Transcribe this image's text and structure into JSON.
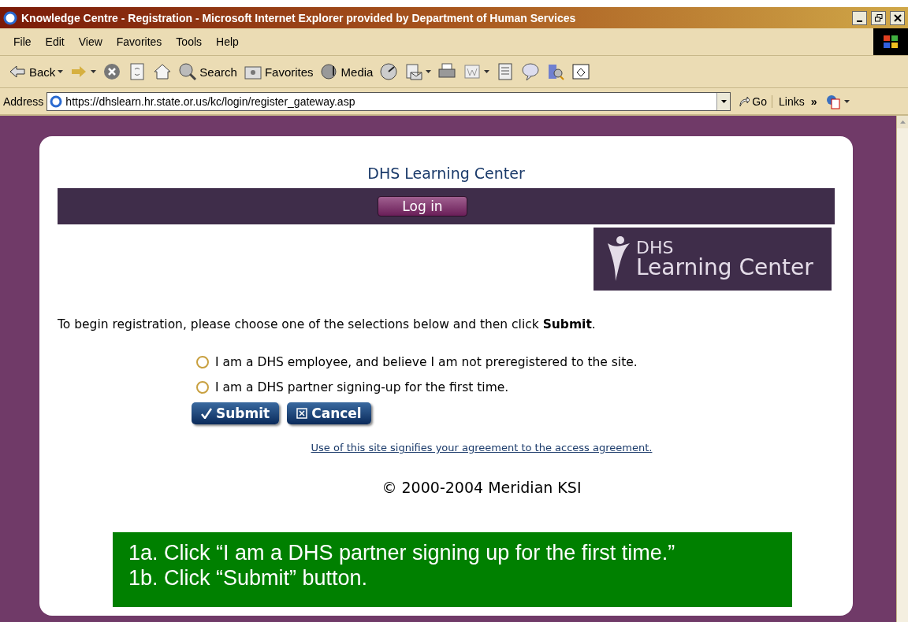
{
  "window": {
    "title": "Knowledge Centre - Registration - Microsoft Internet Explorer provided by Department of Human Services"
  },
  "menu": [
    "File",
    "Edit",
    "View",
    "Favorites",
    "Tools",
    "Help"
  ],
  "toolbar": [
    {
      "kind": "back",
      "label": "Back"
    },
    {
      "kind": "forward"
    },
    {
      "kind": "stop"
    },
    {
      "kind": "refresh"
    },
    {
      "kind": "home"
    },
    {
      "kind": "search",
      "label": "Search"
    },
    {
      "kind": "favorites",
      "label": "Favorites"
    },
    {
      "kind": "media",
      "label": "Media"
    },
    {
      "kind": "history"
    },
    {
      "kind": "mail"
    },
    {
      "kind": "print"
    },
    {
      "kind": "edit"
    },
    {
      "kind": "discuss"
    },
    {
      "kind": "messenger"
    },
    {
      "kind": "research"
    },
    {
      "kind": "window"
    }
  ],
  "address": {
    "label": "Address",
    "value": "https://dhslearn.hr.state.or.us/kc/login/register_gateway.asp",
    "go": "Go",
    "links": "Links",
    "more": "»"
  },
  "page": {
    "heading": "DHS Learning Center",
    "login_button": "Log in",
    "logo": [
      "DHS",
      "Learning Center"
    ],
    "instruction": "To begin registration, please choose one of the selections below and then click **Submit**.",
    "options": [
      {
        "label": "I am a DHS employee, and believe I am not preregistered to the site.",
        "selected": false
      },
      {
        "label": "I am a DHS partner signing-up for the first time.",
        "selected": false
      }
    ],
    "buttons": [
      {
        "kind": "submit",
        "label": "Submit"
      },
      {
        "kind": "cancel",
        "label": "Cancel"
      }
    ],
    "agreement_link": "Use of this site signifies your agreement to the access agreement.",
    "copyright": "© 2000-2004 Meridian KSI"
  },
  "callout": [
    "1a. Click “I am a DHS partner signing up for the first time.”",
    "1b. Click “Submit” button."
  ]
}
